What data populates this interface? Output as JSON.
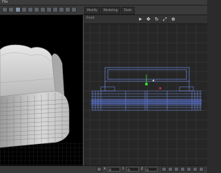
{
  "menubar": {
    "items": [
      "File"
    ]
  },
  "toolbar": {
    "tabs": [
      "Modify",
      "Modeling",
      "Tools"
    ]
  },
  "left_viewport": {
    "label": ""
  },
  "right_viewport": {
    "label": "Front",
    "icons": [
      "select-arrow-icon",
      "move-icon",
      "rotate-icon",
      "scale-icon",
      "orbit-icon"
    ]
  },
  "statusbar": {
    "fields": [
      "0",
      "0",
      "0"
    ],
    "axis_labels": [
      "X",
      "Y",
      "Z"
    ]
  },
  "colors": {
    "background": "#2b2b2b",
    "viewport_left": "#000000",
    "viewport_right": "#262626",
    "grid": "#3a3a3a",
    "wire_blue": "#7f9cff",
    "pivot_green": "#35e03a",
    "pivot_red": "#e03030"
  }
}
